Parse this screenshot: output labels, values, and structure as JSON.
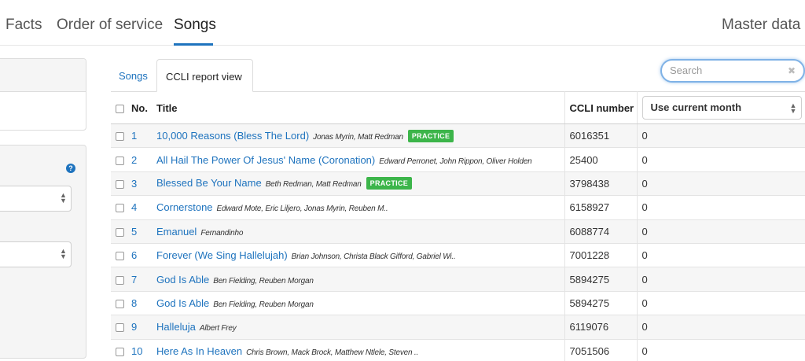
{
  "nav": {
    "items": [
      "Facts",
      "Order of service",
      "Songs"
    ],
    "active": "Songs",
    "right_item": "Master data"
  },
  "tabs": {
    "songs": "Songs",
    "ccli_report": "CCLI report view"
  },
  "search": {
    "placeholder": "Search",
    "value": ""
  },
  "table": {
    "headers": {
      "no": "No.",
      "title": "Title",
      "ccli": "CCLI number"
    },
    "month_select": {
      "selected": "Use current month"
    },
    "rows": [
      {
        "no": "1",
        "title": "10,000 Reasons (Bless The Lord)",
        "authors": "Jonas Myrin, Matt Redman",
        "badge": "PRACTICE",
        "ccli": "6016351",
        "usage": "0"
      },
      {
        "no": "2",
        "title": "All Hail The Power Of Jesus' Name (Coronation)",
        "authors": "Edward Perronet, John Rippon, Oliver Holden",
        "badge": "",
        "ccli": "25400",
        "usage": "0"
      },
      {
        "no": "3",
        "title": "Blessed Be Your Name",
        "authors": "Beth Redman, Matt Redman",
        "badge": "PRACTICE",
        "ccli": "3798438",
        "usage": "0"
      },
      {
        "no": "4",
        "title": "Cornerstone",
        "authors": "Edward Mote, Eric Liljero, Jonas Myrin, Reuben M..",
        "badge": "",
        "ccli": "6158927",
        "usage": "0"
      },
      {
        "no": "5",
        "title": "Emanuel",
        "authors": "Fernandinho",
        "badge": "",
        "ccli": "6088774",
        "usage": "0"
      },
      {
        "no": "6",
        "title": "Forever (We Sing Hallelujah)",
        "authors": "Brian Johnson, Christa Black Gifford, Gabriel Wi..",
        "badge": "",
        "ccli": "7001228",
        "usage": "0"
      },
      {
        "no": "7",
        "title": "God Is Able",
        "authors": "Ben Fielding, Reuben Morgan",
        "badge": "",
        "ccli": "5894275",
        "usage": "0"
      },
      {
        "no": "8",
        "title": "God Is Able",
        "authors": "Ben Fielding, Reuben Morgan",
        "badge": "",
        "ccli": "5894275",
        "usage": "0"
      },
      {
        "no": "9",
        "title": "Halleluja",
        "authors": "Albert Frey",
        "badge": "",
        "ccli": "6119076",
        "usage": "0"
      },
      {
        "no": "10",
        "title": "Here As In Heaven",
        "authors": "Chris Brown, Mack Brock, Matthew Ntlele, Steven ..",
        "badge": "",
        "ccli": "7051506",
        "usage": "0"
      }
    ]
  },
  "colors": {
    "link": "#1e73be",
    "badge": "#3cb54a",
    "active_underline": "#1e73be"
  },
  "icons": {
    "help": "question-circle-icon",
    "clear": "clear-x-icon",
    "select": "updown-arrows-icon",
    "checkbox": "checkbox-icon"
  }
}
